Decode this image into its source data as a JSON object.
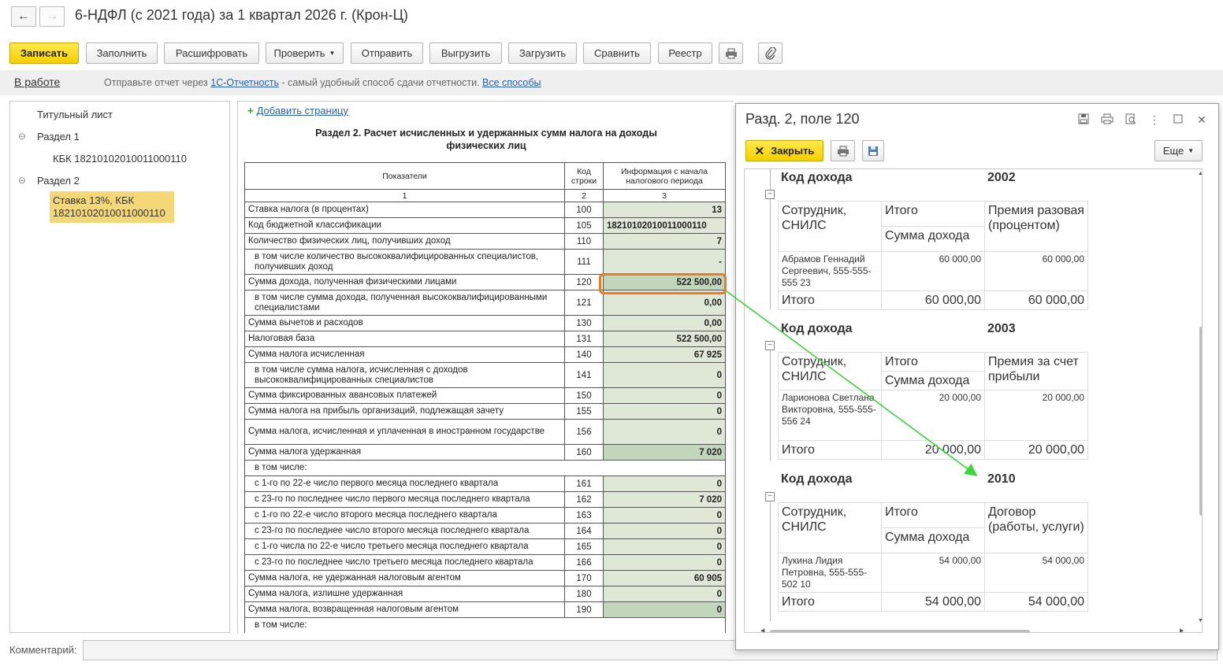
{
  "window": {
    "title": "6-НДФЛ (с 2021 года) за 1 квартал 2026 г. (Крон-Ц)",
    "back_icon": "←",
    "forward_icon": "→"
  },
  "toolbar": {
    "save": "Записать",
    "fill": "Заполнить",
    "decode": "Расшифровать",
    "check": "Проверить",
    "send": "Отправить",
    "export": "Выгрузить",
    "import": "Загрузить",
    "compare": "Сравнить",
    "registry": "Реестр",
    "print_icon": "printer-icon",
    "attach_icon": "paperclip-icon"
  },
  "infobar": {
    "status": "В работе",
    "message_prefix": "Отправьте отчет через",
    "service_link": "1С-Отчетность",
    "message_middle": "- самый удобный способ сдачи отчетности.",
    "all_methods_link": "Все способы"
  },
  "tree": {
    "title_page": "Титульный лист",
    "section1": "Раздел 1",
    "section1_kbk": "КБК 18210102010011000110",
    "section2": "Раздел 2",
    "section2_rate_kbk": "Ставка 13%, КБК 18210102010011000110"
  },
  "report": {
    "add_page": "Добавить страницу",
    "section_title": "Раздел 2. Расчет исчисленных и удержанных сумм налога на доходы физических лиц",
    "headers": {
      "indicators": "Показатели",
      "code": "Код строки",
      "info": "Информация с начала налогового периода",
      "n1": "1",
      "n2": "2",
      "n3": "3"
    },
    "rows": [
      {
        "label": "Ставка налога (в процентах)",
        "code": "100",
        "value": "13"
      },
      {
        "label": "Код бюджетной классификации",
        "code": "105",
        "value": "18210102010011000110"
      },
      {
        "label": "Количество физических лиц, получивших доход",
        "code": "110",
        "value": "7"
      },
      {
        "label": "в том числе количество высококвалифицированных специалистов, получивших доход",
        "code": "111",
        "value": "-"
      },
      {
        "label": "Сумма дохода, полученная физическими лицами",
        "code": "120",
        "value": "522 500,00"
      },
      {
        "label": "в том числе сумма дохода, полученная высококвалифицированными специалистами",
        "code": "121",
        "value": "0,00"
      },
      {
        "label": "Сумма вычетов и расходов",
        "code": "130",
        "value": "0,00"
      },
      {
        "label": "Налоговая база",
        "code": "131",
        "value": "522 500,00"
      },
      {
        "label": "Сумма налога исчисленная",
        "code": "140",
        "value": "67 925"
      },
      {
        "label": "в том числе сумма налога, исчисленная с доходов высококвалифицированных специалистов",
        "code": "141",
        "value": "0"
      },
      {
        "label": "Сумма фиксированных авансовых платежей",
        "code": "150",
        "value": "0"
      },
      {
        "label": "Сумма налога на прибыль организаций, подлежащая зачету",
        "code": "155",
        "value": "0"
      },
      {
        "label": "Сумма налога, исчисленная и уплаченная в иностранном государстве",
        "code": "156",
        "value": "0"
      },
      {
        "label": "Сумма налога удержанная",
        "code": "160",
        "value": "7 020"
      },
      {
        "label": "в том числе:"
      },
      {
        "label": "с 1-го по 22-е число первого месяца последнего квартала",
        "code": "161",
        "value": "0"
      },
      {
        "label": "с 23-го по последнее число первого месяца последнего квартала",
        "code": "162",
        "value": "7 020"
      },
      {
        "label": "с 1-го по 22-е число второго месяца последнего квартала",
        "code": "163",
        "value": "0"
      },
      {
        "label": "с 23-го по последнее число второго месяца последнего квартала",
        "code": "164",
        "value": "0"
      },
      {
        "label": "с 1-го числа по 22-е число третьего месяца последнего квартала",
        "code": "165",
        "value": "0"
      },
      {
        "label": "с 23-го по последнее число третьего месяца последнего квартала",
        "code": "166",
        "value": "0"
      },
      {
        "label": "Сумма налога, не удержанная налоговым агентом",
        "code": "170",
        "value": "60 905"
      },
      {
        "label": "Сумма налога, излишне удержанная",
        "code": "180",
        "value": "0"
      },
      {
        "label": "Сумма налога, возвращенная налоговым агентом",
        "code": "190",
        "value": "0"
      },
      {
        "label": "в том числе:"
      }
    ]
  },
  "comment": {
    "label": "Комментарий:",
    "value": ""
  },
  "popup": {
    "title": "Разд. 2, поле 120",
    "close": "Закрыть",
    "more": "Еще",
    "icons": [
      "save-icon",
      "print-icon",
      "preview-icon",
      "menu-icon",
      "maximize-icon",
      "close-icon"
    ],
    "groups": [
      {
        "income_code_label": "Код дохода",
        "income_code": "2002",
        "col_employee": "Сотрудник, СНИЛС",
        "col_total": "Итого",
        "col_sum": "Сумма дохода",
        "col_type": "Премия разовая (процентом)",
        "employee": "Абрамов Геннадий Сергеевич, 555-555-555 23",
        "amount": "60 000,00",
        "amount_type": "60 000,00",
        "total_label": "Итого",
        "total": "60 000,00",
        "total_type": "60 000,00"
      },
      {
        "income_code_label": "Код дохода",
        "income_code": "2003",
        "col_employee": "Сотрудник, СНИЛС",
        "col_total": "Итого",
        "col_sum": "Сумма дохода",
        "col_type": "Премия за счет прибыли",
        "employee": "Ларионова Светлана Викторовна, 555-555-556 24",
        "amount": "20 000,00",
        "amount_type": "20 000,00",
        "total_label": "Итого",
        "total": "20 000,00",
        "total_type": "20 000,00"
      },
      {
        "income_code_label": "Код дохода",
        "income_code": "2010",
        "col_employee": "Сотрудник, СНИЛС",
        "col_total": "Итого",
        "col_sum": "Сумма дохода",
        "col_type": "Договор (работы, услуги)",
        "employee": "Лукина Лидия Петровна, 555-555-502 10",
        "amount": "54 000,00",
        "amount_type": "54 000,00",
        "total_label": "Итого",
        "total": "54 000,00",
        "total_type": "54 000,00"
      }
    ]
  },
  "colors": {
    "primary_button": "#f4cf00",
    "highlight": "#ef7b1e",
    "arrow": "#3bd43b",
    "cell_fill": "#dfe8d6",
    "selected_tree": "#f4d776"
  }
}
